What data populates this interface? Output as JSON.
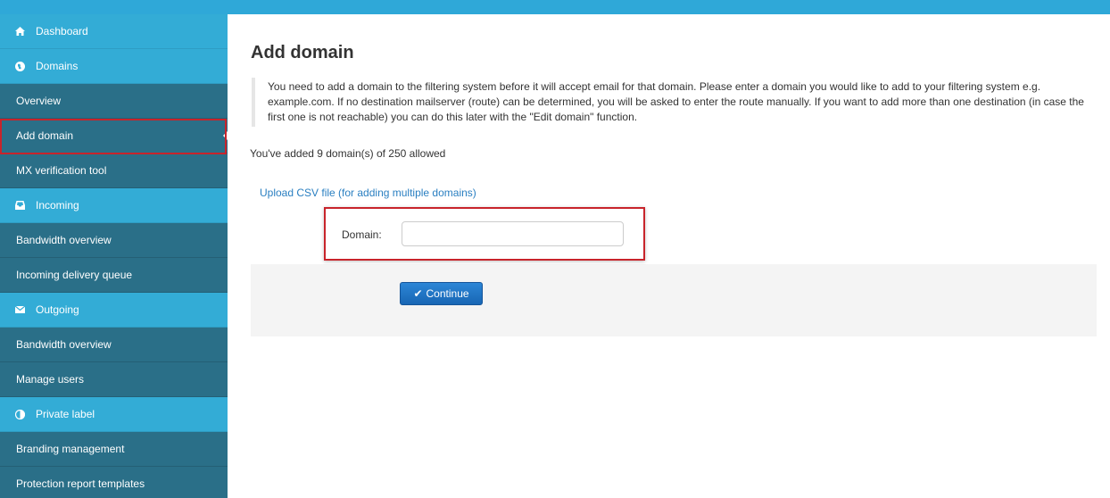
{
  "sidebar": {
    "items": [
      {
        "label": "Dashboard",
        "icon": "home-icon"
      },
      {
        "label": "Domains",
        "icon": "globe-icon"
      },
      {
        "label": "Overview"
      },
      {
        "label": "Add domain"
      },
      {
        "label": "MX verification tool"
      },
      {
        "label": "Incoming",
        "icon": "inbox-icon"
      },
      {
        "label": "Bandwidth overview"
      },
      {
        "label": "Incoming delivery queue"
      },
      {
        "label": "Outgoing",
        "icon": "envelope-icon"
      },
      {
        "label": "Bandwidth overview"
      },
      {
        "label": "Manage users"
      },
      {
        "label": "Private label",
        "icon": "contrast-icon"
      },
      {
        "label": "Branding management"
      },
      {
        "label": "Protection report templates"
      }
    ]
  },
  "main": {
    "title": "Add domain",
    "intro": "You need to add a domain to the filtering system before it will accept email for that domain. Please enter a domain you would like to add to your filtering system e.g. example.com. If no destination mailserver (route) can be determined, you will be asked to enter the route manually. If you want to add more than one destination (in case the first one is not reachable) you can do this later with the \"Edit domain\" function.",
    "quota": "You've added 9 domain(s) of 250 allowed",
    "upload_link": "Upload CSV file (for adding multiple domains)",
    "form": {
      "domain_label": "Domain:",
      "domain_value": "",
      "domain_placeholder": "",
      "continue_label": "Continue"
    }
  },
  "colors": {
    "sidebar_dark": "#2a6f88",
    "sidebar_section": "#33acd6",
    "topbar": "#2fa8d8",
    "highlight": "#c8242b",
    "primary_button": "#1f74c4",
    "link": "#2a7fc1"
  }
}
